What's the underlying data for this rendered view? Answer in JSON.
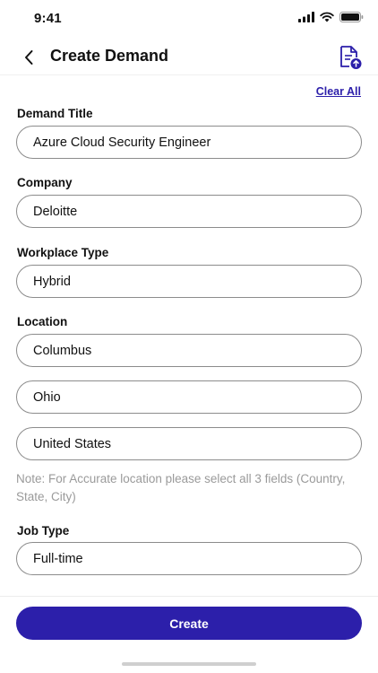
{
  "status_bar": {
    "time": "9:41"
  },
  "header": {
    "title": "Create Demand"
  },
  "form": {
    "clear_all_label": "Clear All",
    "fields": [
      {
        "label": "Demand Title",
        "value": "Azure Cloud Security Engineer"
      },
      {
        "label": "Company",
        "value": "Deloitte"
      },
      {
        "label": "Workplace Type",
        "value": "Hybrid"
      },
      {
        "label": "Location",
        "values": [
          "Columbus",
          "Ohio",
          "United States"
        ]
      },
      {
        "label": "Job Type",
        "value": "Full-time"
      }
    ],
    "location_note": "Note: For Accurate location please select all 3 fields (Country, State, City)"
  },
  "footer": {
    "create_label": "Create"
  },
  "colors": {
    "primary": "#2c1faa",
    "border": "#8c8c8c",
    "note": "#9a9a9a"
  },
  "icons": [
    "back-chevron-icon",
    "document-upload-icon",
    "signal-icon",
    "wifi-icon",
    "battery-icon"
  ]
}
